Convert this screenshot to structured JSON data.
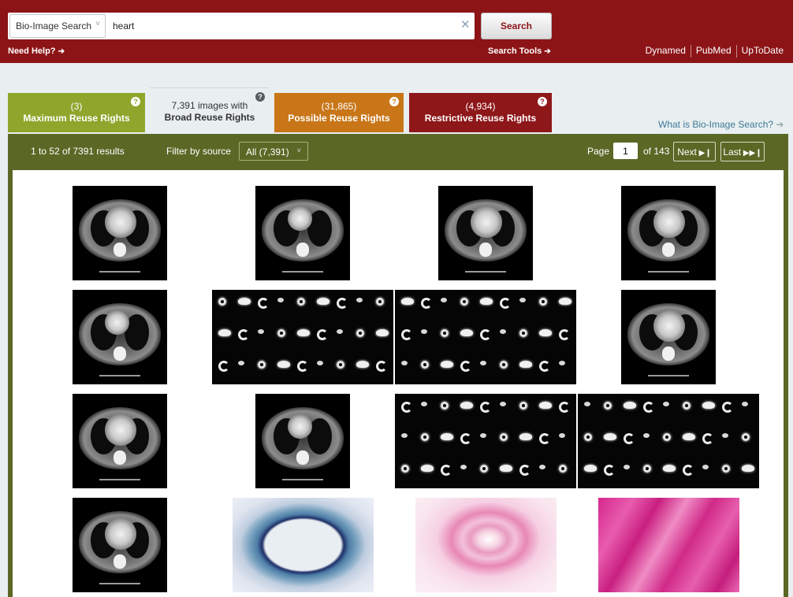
{
  "header": {
    "db_selector": "Bio-Image Search",
    "search_value": "heart",
    "search_button": "Search",
    "need_help": "Need Help?",
    "search_tools": "Search Tools",
    "external_links": [
      "Dynamed",
      "PubMed",
      "UpToDate"
    ]
  },
  "tabs": [
    {
      "count": "(3)",
      "label": "Maximum Reuse Rights"
    },
    {
      "count": "7,391 images with",
      "label": "Broad Reuse Rights",
      "active": true
    },
    {
      "count": "(31,865)",
      "label": "Possible Reuse Rights"
    },
    {
      "count": "(4,934)",
      "label": "Restrictive Reuse Rights"
    }
  ],
  "help_glyph": "?",
  "what_is_link": "What is Bio-Image Search?",
  "results": {
    "count_text": "1 to 52 of 7391 results",
    "filter_label": "Filter by source",
    "filter_value": "All (7,391)",
    "page_label": "Page",
    "page_value": "1",
    "page_of": "of 143",
    "next_label": "Next",
    "last_label": "Last"
  },
  "thumbnails": [
    {
      "type": "ct-scan"
    },
    {
      "type": "ct-scan"
    },
    {
      "type": "ct-scan"
    },
    {
      "type": "ct-scan"
    },
    {
      "type": "ct-scan"
    },
    {
      "type": "nuclear-perfusion"
    },
    {
      "type": "nuclear-perfusion"
    },
    {
      "type": "ct-scan"
    },
    {
      "type": "ct-scan"
    },
    {
      "type": "ct-scan"
    },
    {
      "type": "nuclear-perfusion"
    },
    {
      "type": "nuclear-perfusion"
    },
    {
      "type": "ct-scan"
    },
    {
      "type": "histology-trichrome"
    },
    {
      "type": "histology-h-and-e"
    },
    {
      "type": "histology-h-and-e"
    }
  ],
  "colors": {
    "header": "#8c1417",
    "max_reuse": "#8ea62c",
    "possible_reuse": "#c87618",
    "restrictive_reuse": "#8e1719",
    "results_bar": "#5b6725",
    "link": "#3e7a95"
  },
  "icons": [
    "chevron-down-icon",
    "clear-icon",
    "arrow-right-icon",
    "help-icon",
    "next-icon",
    "last-icon"
  ]
}
